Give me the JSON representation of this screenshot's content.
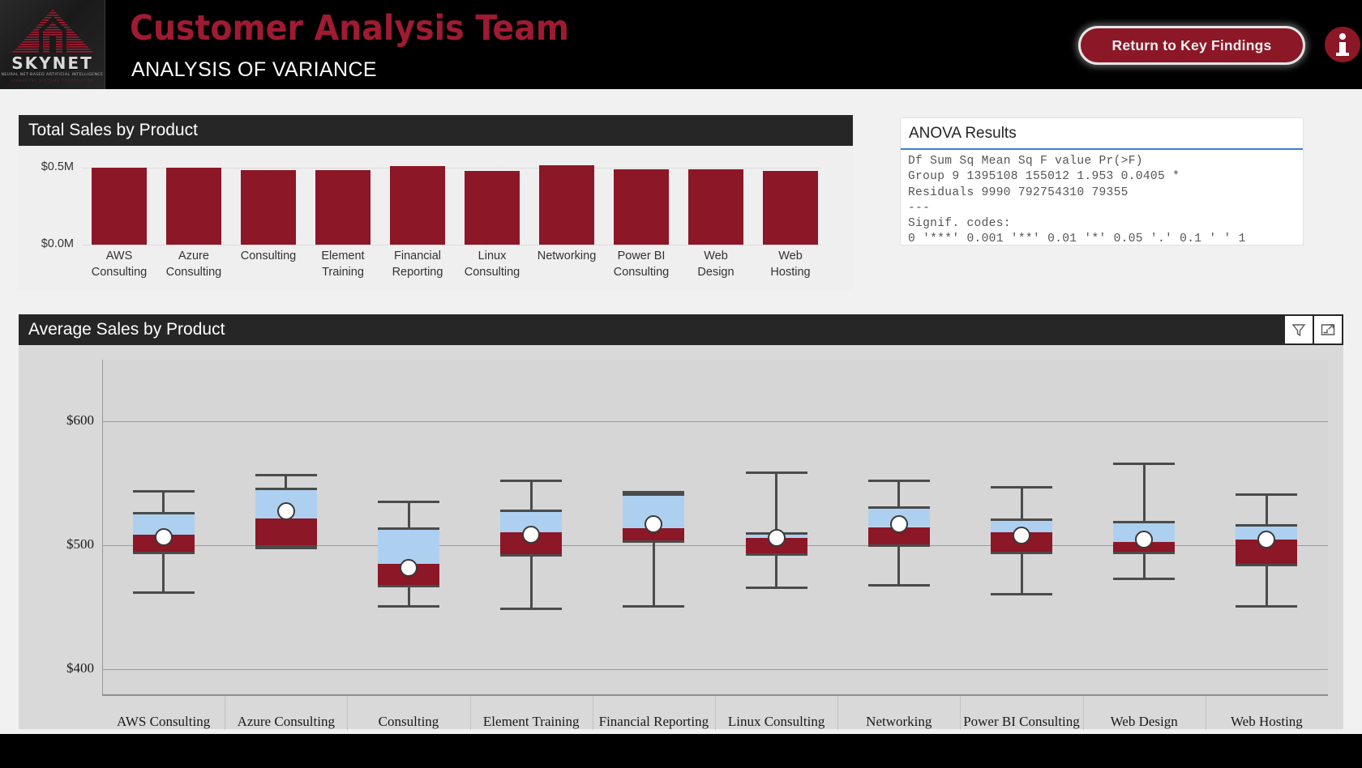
{
  "header": {
    "logo": {
      "word": "SKYNET",
      "tagline": "NEURAL NET-BASED ARTIFICIAL INTELLIGENCE",
      "tagline2": "CYBERDYNE SYSTEMS CORPORATION"
    },
    "title": "Customer Analysis Team",
    "subtitle": "ANALYSIS OF VARIANCE",
    "return_button": "Return to Key Findings",
    "info_icon": "info-icon",
    "brand_red": "#9e1b32",
    "button_red": "#8c1726"
  },
  "anova": {
    "title": "ANOVA Results",
    "text": "Df Sum Sq Mean Sq F value Pr(>F)\nGroup 9 1395108 155012 1.953 0.0405 *\nResiduals 9990 792754310 79355\n---\nSignif. codes:\n0 '***' 0.001 '**' 0.01 '*' 0.05 '.' 0.1 ' ' 1",
    "table": {
      "columns": [
        "",
        "Df",
        "Sum Sq",
        "Mean Sq",
        "F value",
        "Pr(>F)",
        "signif"
      ],
      "rows": [
        [
          "Group",
          "9",
          "1395108",
          "155012",
          "1.953",
          "0.0405",
          "*"
        ],
        [
          "Residuals",
          "9990",
          "792754310",
          "79355",
          "",
          "",
          ""
        ]
      ]
    },
    "accent": "#3a80d6"
  },
  "total_sales_card": {
    "title": "Total Sales by Product"
  },
  "avg_sales_card": {
    "title": "Average Sales by Product",
    "icons": [
      "filter-icon",
      "focus-mode-icon"
    ]
  },
  "chart_data": [
    {
      "type": "bar",
      "title": "Total Sales by Product",
      "xlabel": "",
      "ylabel": "",
      "ylim": [
        0,
        550000
      ],
      "grid": true,
      "ticks": [
        "$0.0M",
        "$0.5M"
      ],
      "tick_values": [
        0,
        500000
      ],
      "categories": [
        "AWS Consulting",
        "Azure Consulting",
        "Consulting",
        "Element Training",
        "Financial Reporting",
        "Linux Consulting",
        "Networking",
        "Power BI Consulting",
        "Web Design",
        "Web Hosting"
      ],
      "category_lines": [
        [
          "AWS",
          "Consulting"
        ],
        [
          "Azure",
          "Consulting"
        ],
        [
          "Consulting"
        ],
        [
          "Element",
          "Training"
        ],
        [
          "Financial",
          "Reporting"
        ],
        [
          "Linux",
          "Consulting"
        ],
        [
          "Networking"
        ],
        [
          "Power BI",
          "Consulting"
        ],
        [
          "Web",
          "Design"
        ],
        [
          "Web",
          "Hosting"
        ]
      ],
      "values": [
        500000,
        502000,
        487000,
        486000,
        514000,
        481000,
        518000,
        492000,
        494000,
        483000
      ],
      "color": "#8c1726"
    },
    {
      "type": "box",
      "title": "Average Sales by Product",
      "xlabel": "",
      "ylabel": "",
      "ylim": [
        380,
        650
      ],
      "ticks": [
        "$400",
        "$500",
        "$600"
      ],
      "tick_values": [
        400,
        500,
        600
      ],
      "grid": true,
      "categories": [
        "AWS Consulting",
        "Azure Consulting",
        "Consulting",
        "Element Training",
        "Financial Reporting",
        "Linux Consulting",
        "Networking",
        "Power BI Consulting",
        "Web Design",
        "Web Hosting"
      ],
      "boxes": [
        {
          "name": "AWS Consulting",
          "min": 463,
          "q1": 494,
          "median": 509,
          "q3": 526,
          "max": 545,
          "mean": 507
        },
        {
          "name": "Azure Consulting",
          "min": 499,
          "q1": 499,
          "median": 522,
          "q3": 546,
          "max": 558,
          "mean": 528
        },
        {
          "name": "Consulting",
          "min": 452,
          "q1": 467,
          "median": 485,
          "q3": 514,
          "max": 536,
          "mean": 482
        },
        {
          "name": "Element Training",
          "min": 450,
          "q1": 492,
          "median": 511,
          "q3": 528,
          "max": 553,
          "mean": 509
        },
        {
          "name": "Financial Reporting",
          "min": 452,
          "q1": 503,
          "median": 514,
          "q3": 541,
          "max": 544,
          "mean": 517
        },
        {
          "name": "Linux Consulting",
          "min": 467,
          "q1": 493,
          "median": 506,
          "q3": 510,
          "max": 560,
          "mean": 506
        },
        {
          "name": "Networking",
          "min": 469,
          "q1": 500,
          "median": 515,
          "q3": 531,
          "max": 553,
          "mean": 517
        },
        {
          "name": "Power BI Consulting",
          "min": 462,
          "q1": 494,
          "median": 511,
          "q3": 521,
          "max": 548,
          "mean": 508
        },
        {
          "name": "Web Design",
          "min": 474,
          "q1": 494,
          "median": 503,
          "q3": 519,
          "max": 567,
          "mean": 505
        },
        {
          "name": "Web Hosting",
          "min": 452,
          "q1": 484,
          "median": 505,
          "q3": 516,
          "max": 542,
          "mean": 505
        }
      ],
      "box_upper_color": "#aed0f0",
      "box_lower_color": "#8c1726",
      "whisker_color": "#4b4b4b",
      "mean_marker": "white-circle"
    }
  ]
}
